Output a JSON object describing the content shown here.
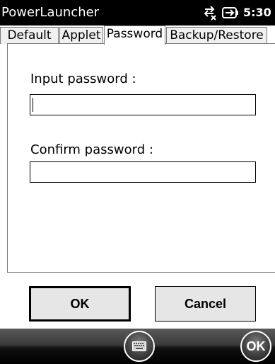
{
  "titlebar": {
    "app_title": "PowerLauncher",
    "time": "5:30",
    "icons": [
      "signal-icon",
      "battery-icon"
    ]
  },
  "tabs": [
    {
      "label": "Default",
      "active": false
    },
    {
      "label": "Applet",
      "active": false
    },
    {
      "label": "Password",
      "active": true
    },
    {
      "label": "Backup/Restore",
      "active": false
    }
  ],
  "form": {
    "input_password_label": "Input password :",
    "input_password_value": "",
    "confirm_password_label": "Confirm password :",
    "confirm_password_value": ""
  },
  "buttons": {
    "ok_label": "OK",
    "cancel_label": "Cancel"
  },
  "bottombar": {
    "keyboard_icon": "keyboard-icon",
    "ok_label": "OK"
  }
}
